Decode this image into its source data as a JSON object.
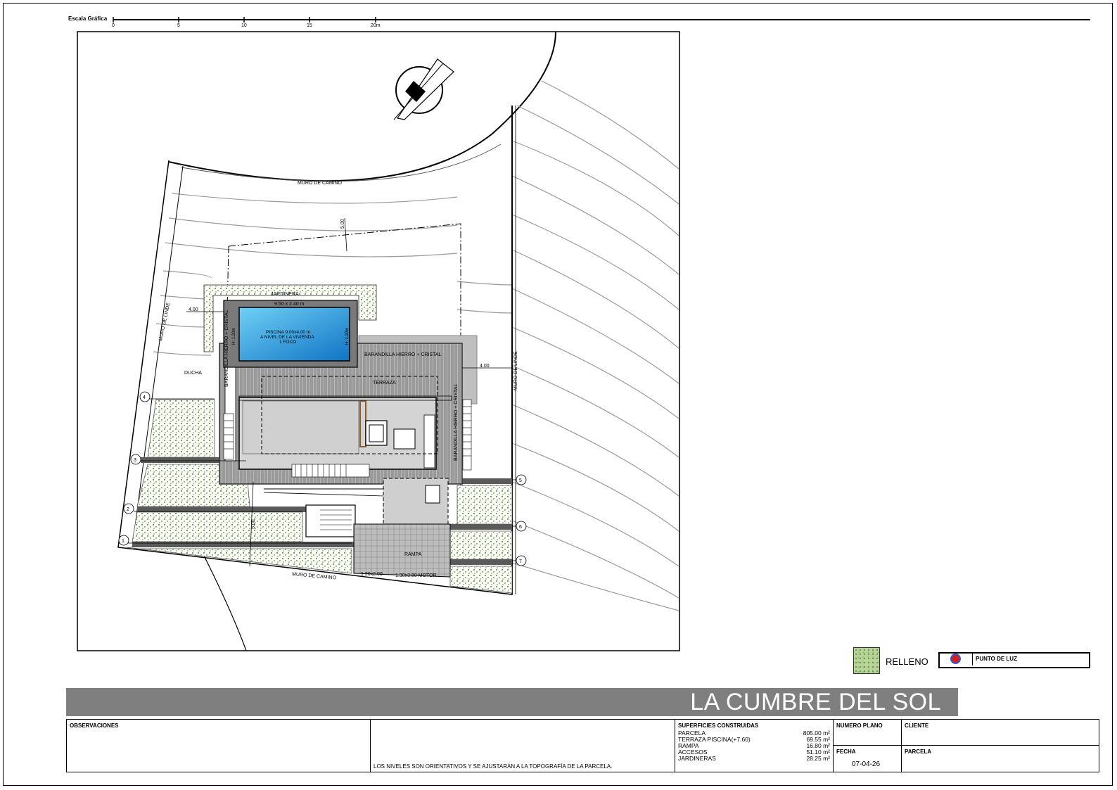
{
  "scale": {
    "label": "Escala Gráfica",
    "ticks": [
      "0",
      "5",
      "10",
      "15",
      "20m"
    ]
  },
  "plan": {
    "labels": {
      "muro_camino_top": "MURO DE CAMINO",
      "muro_camino_bottom": "MURO DE CAMINO",
      "muro_lindero_left": "MURO DE LINDE",
      "muro_lindero_right": "MURO DE LINDE",
      "jardinera": "JARDINERA",
      "pool_dims": "9.50 x 2.40 m",
      "piscina_line1": "PISCINA 9.00x4.00 m",
      "piscina_line2": "A NIVEL DE LA VIVIENDA",
      "piscina_line3": "1 FOCO",
      "pool_depth_left": "H: 1.20m",
      "pool_depth_right": "H: 1.20m",
      "barandilla_top": "BARANDILLA HIERRO + CRISTAL",
      "barandilla_left": "BARANDILLA HIERRO + CRISTAL",
      "barandilla_right": "BARANDILLA HIERRO + CRISTAL",
      "terraza": "TERRAZA",
      "ducha": "DUCHA",
      "rampa": "RAMPA",
      "level_left": "4.00",
      "level_right": "4.00",
      "level_vertical": "5.00",
      "level_road": "5.00",
      "puerta_bottom": "1.20x2.00",
      "motor": "1.30x3.80 MOTOR"
    },
    "grid_markers": [
      "1",
      "2",
      "3",
      "4",
      "5",
      "6",
      "7"
    ]
  },
  "legend": {
    "relleno_label": "RELLENO",
    "punto_luz_label": "PUNTO DE LUZ",
    "relleno_color": "#8fb56a",
    "luz_color": "#d62020"
  },
  "title": "LA CUMBRE DEL SOL",
  "title_block": {
    "observaciones_label": "OBSERVACIONES",
    "note": "LOS NIVELES SON ORIENTATIVOS Y SE AJUSTARÁN A LA TOPOGRAFÍA DE LA PARCELA.",
    "superficies_label": "SUPERFICIES CONSTRUIDAS",
    "superficies": [
      {
        "name": "PARCELA",
        "value": "805.00 m²"
      },
      {
        "name": "TERRAZA PISCINA(+7.60)",
        "value": "69.55 m²"
      },
      {
        "name": "RAMPA",
        "value": "16.80 m²"
      },
      {
        "name": "ACCESOS",
        "value": "51.10 m²"
      },
      {
        "name": "JARDINERAS",
        "value": "28.25 m²"
      }
    ],
    "numero_plano_label": "NUMERO PLANO",
    "cliente_label": "CLIENTE",
    "fecha_label": "FECHA",
    "fecha_value": "07-04-26",
    "parcela_label": "PARCELA"
  }
}
